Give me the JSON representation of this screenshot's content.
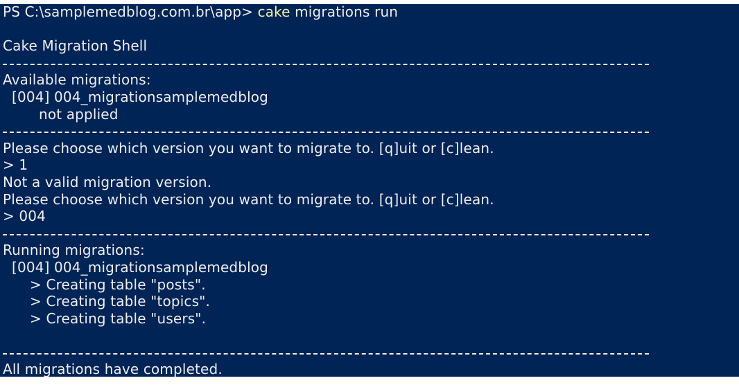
{
  "terminal": {
    "background": "#012456",
    "text_color": "#EEEDF0",
    "command_color": "#F9F1A5",
    "prompt": "PS C:\\samplemedblog.com.br\\app> ",
    "command_keyword": "cake",
    "command_args": " migrations run",
    "lines": [
      "",
      "Cake Migration Shell",
      "---------------------------------------------------------------",
      "Available migrations:",
      "  [004] 004_migrationsamplemedblog",
      "        not applied",
      "---------------------------------------------------------------",
      "Please choose which version you want to migrate to. [q]uit or [c]lean.",
      "> 1",
      "Not a valid migration version.",
      "Please choose which version you want to migrate to. [q]uit or [c]lean.",
      "> 004",
      "---------------------------------------------------------------",
      "Running migrations:",
      "  [004] 004_migrationsamplemedblog",
      "      > Creating table \"posts\".",
      "      > Creating table \"topics\".",
      "      > Creating table \"users\".",
      "",
      "---------------------------------------------------------------",
      "All migrations have completed."
    ]
  }
}
